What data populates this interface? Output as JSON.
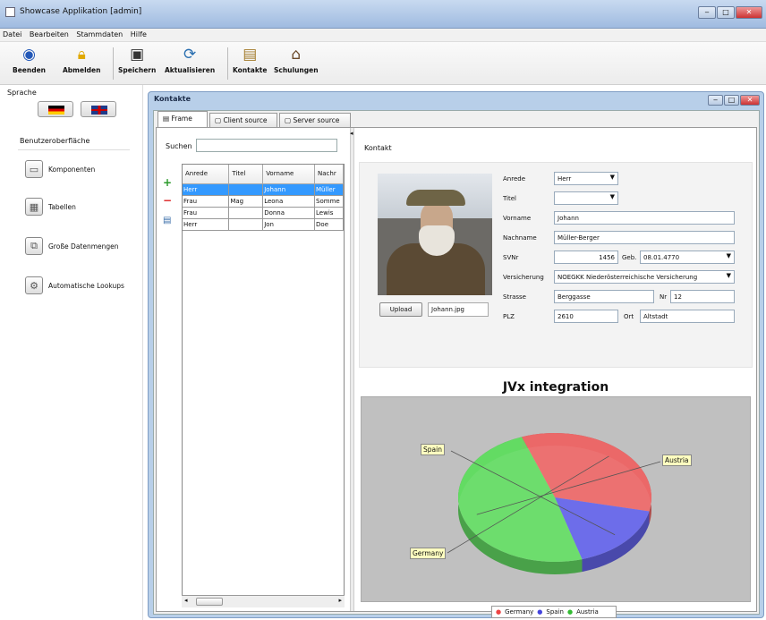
{
  "window": {
    "title": "Showcase Applikation [admin]"
  },
  "menu": [
    "Datei",
    "Bearbeiten",
    "Stammdaten",
    "Hilfe"
  ],
  "toolbar": {
    "beenden": "Beenden",
    "abmelden": "Abmelden",
    "speichern": "Speichern",
    "aktualisieren": "Aktualisieren",
    "kontakte": "Kontakte",
    "schulungen": "Schulungen"
  },
  "sidebar": {
    "sprache_label": "Sprache",
    "section_label": "Benutzeroberfläche",
    "items": [
      "Komponenten",
      "Tabellen",
      "Große Datenmengen",
      "Automatische Lookups"
    ]
  },
  "internal_frame": {
    "title": "Kontakte",
    "tabs": [
      "Frame",
      "Client source",
      "Server source"
    ]
  },
  "search": {
    "label": "Suchen",
    "value": ""
  },
  "table": {
    "columns": [
      "Anrede",
      "Titel",
      "Vorname",
      "Nachr"
    ],
    "rows": [
      [
        "Herr",
        "",
        "Johann",
        "Müller"
      ],
      [
        "Frau",
        "Mag",
        "Leona",
        "Somme"
      ],
      [
        "Frau",
        "",
        "Donna",
        "Lewis"
      ],
      [
        "Herr",
        "",
        "Jon",
        "Doe"
      ]
    ]
  },
  "contact": {
    "section_label": "Kontakt",
    "upload_label": "Upload",
    "file_name": "Johann.jpg",
    "fields": {
      "anrede_label": "Anrede",
      "anrede": "Herr",
      "titel_label": "Titel",
      "titel": "",
      "vorname_label": "Vorname",
      "vorname": "Johann",
      "nachname_label": "Nachname",
      "nachname": "Müller-Berger",
      "svnr_label": "SVNr",
      "svnr": "1456",
      "geb_label": "Geb.",
      "geb": "08.01.4770",
      "versicherung_label": "Versicherung",
      "versicherung": "NOEGKK Niederösterreichische Versicherung",
      "strasse_label": "Strasse",
      "strasse": "Berggasse",
      "nr_label": "Nr",
      "nr": "12",
      "plz_label": "PLZ",
      "plz": "2610",
      "ort_label": "Ort",
      "ort": "Altstadt"
    }
  },
  "chart_data": {
    "type": "pie",
    "title": "JVx integration",
    "slices": [
      {
        "label": "Germany",
        "value": 34,
        "color": "#f06a6a"
      },
      {
        "label": "Spain",
        "value": 17,
        "color": "#6666ee"
      },
      {
        "label": "Austria",
        "value": 49,
        "color": "#66e066"
      }
    ],
    "legend": [
      "Germany",
      "Spain",
      "Austria"
    ],
    "legend_position": "bottom"
  }
}
